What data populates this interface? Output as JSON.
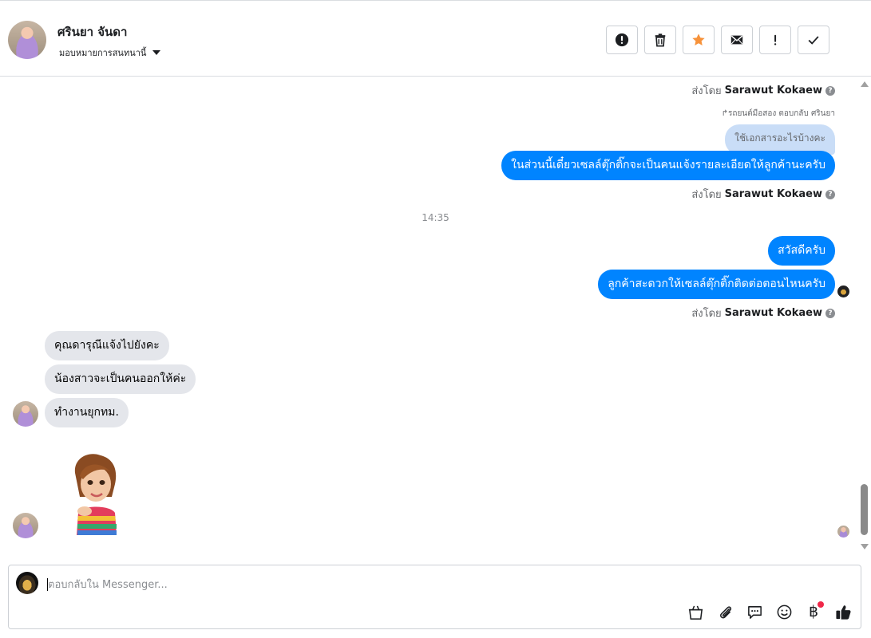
{
  "header": {
    "contact_name": "ศรินยา จันดา",
    "assign_label": "มอบหมายการสนทนานี้",
    "actions": [
      {
        "name": "spam-button",
        "icon": "alert-circle-icon"
      },
      {
        "name": "delete-button",
        "icon": "trash-icon"
      },
      {
        "name": "star-button",
        "icon": "star-icon",
        "color": "#f7923a"
      },
      {
        "name": "mark-unread-button",
        "icon": "envelope-icon"
      },
      {
        "name": "follow-up-button",
        "icon": "exclamation-icon"
      },
      {
        "name": "mark-done-button",
        "icon": "check-icon"
      }
    ]
  },
  "thread": {
    "sent_by_prefix": "ส่งโดย",
    "agent_name": "Sarawut Kokaew",
    "reply_note": "รถยนต์มือสอง ตอบกลับ ศรินยา",
    "quoted_text": "ใช้เอกสารอะไรบ้างคะ",
    "outgoing_1": "ในส่วนนี้เดี๋ยวเซลล์ตุ๊กติ๊กจะเป็นคนแจ้งรายละเอียดให้ลูกค้านะครับ",
    "timestamp": "14:35",
    "outgoing_2": "สวัสดีครับ",
    "outgoing_3": "ลูกค้าสะดวกให้เซลล์ตุ๊กติ๊กติดต่อตอนไหนครับ",
    "incoming": [
      "คุณดารุณีแจ้งไปยังคะ",
      "น้องสาวจะเป็นคนออกให้ค่ะ",
      "ทำงานยุกทม."
    ]
  },
  "composer": {
    "placeholder": "ตอบกลับใน Messenger...",
    "tools": [
      "shopping-bag-icon",
      "paperclip-icon",
      "saved-reply-icon",
      "emoji-icon",
      "baht-icon",
      "like-icon"
    ],
    "baht_glyph": "฿"
  },
  "colors": {
    "outgoing_bubble": "#0084ff",
    "incoming_bubble": "#e4e6eb",
    "quoted_bubble": "#c9ddf7",
    "notification_dot": "#f02849"
  }
}
